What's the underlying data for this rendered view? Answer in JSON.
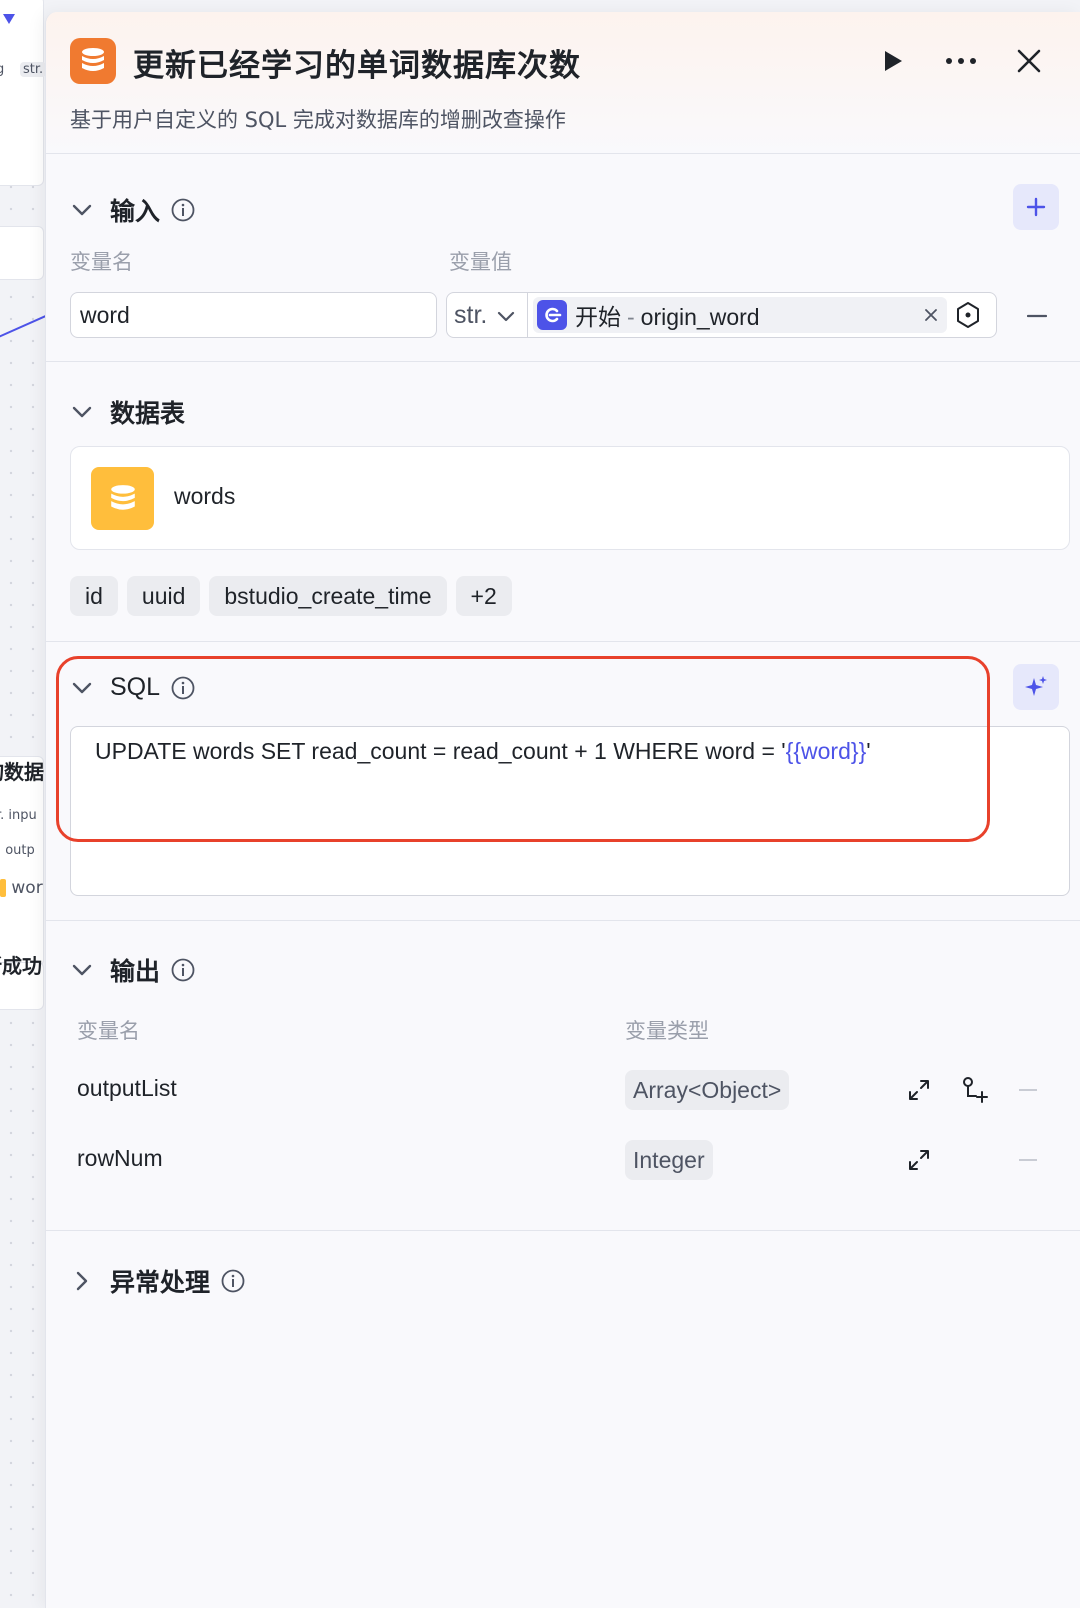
{
  "canvas": {
    "top_card_tags": [
      "g",
      "str."
    ],
    "node_title_fragment": "询数据",
    "node_rows": [
      "r. inpu",
      "] outp",
      "wor"
    ],
    "status_fragment": "所成功"
  },
  "header": {
    "title": "更新已经学习的单词数据库次数",
    "description": "基于用户自定义的 SQL 完成对数据库的增删改查操作"
  },
  "input_section": {
    "title": "输入",
    "col_name": "变量名",
    "col_value": "变量值",
    "rows": [
      {
        "name": "word",
        "type": "str.",
        "ref_node": "开始",
        "ref_sep": "-",
        "ref_var": "origin_word"
      }
    ]
  },
  "table_section": {
    "title": "数据表",
    "table_name": "words",
    "fields": [
      "id",
      "uuid",
      "bstudio_create_time",
      "+2"
    ]
  },
  "sql_section": {
    "title": "SQL",
    "sql_prefix": "UPDATE words SET read_count = read_count + 1 WHERE word = '",
    "sql_var": "{{word}}",
    "sql_suffix": "'"
  },
  "output_section": {
    "title": "输出",
    "col_name": "变量名",
    "col_type": "变量类型",
    "rows": [
      {
        "name": "outputList",
        "type": "Array<Object>"
      },
      {
        "name": "rowNum",
        "type": "Integer"
      }
    ]
  },
  "exception_section": {
    "title": "异常处理"
  },
  "colors": {
    "accent": "#4d53e8",
    "node_icon": "#f07a30",
    "table_icon": "#ffbe3c",
    "highlight": "#e8412b"
  },
  "icons": {
    "node": "database-icon",
    "run": "play-icon",
    "more": "more-horizontal-icon",
    "close": "close-icon",
    "collapse": "chevron-down-icon",
    "expand": "chevron-right-icon",
    "info": "info-icon",
    "add": "plus-icon",
    "ai": "sparkle-icon",
    "expand_view": "expand-arrows-icon",
    "add_child": "add-child-icon"
  }
}
